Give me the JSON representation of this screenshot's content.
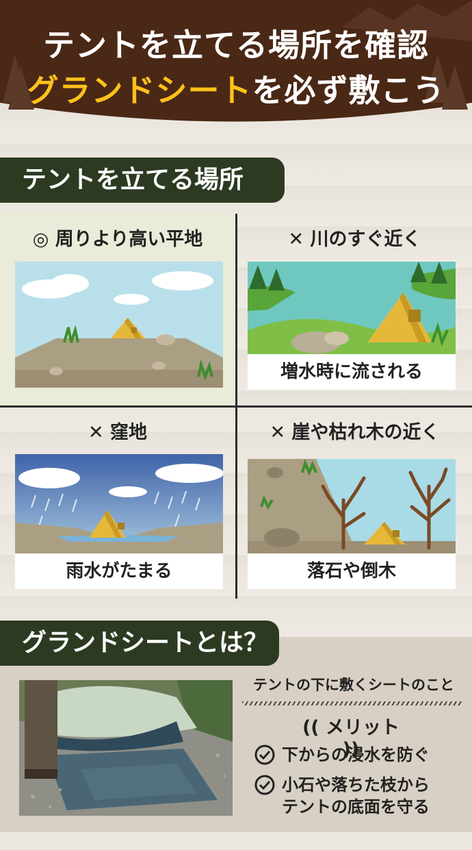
{
  "header": {
    "line1": "テントを立てる場所を確認",
    "line2_highlight": "グランドシート",
    "line2_rest": "を必ず敷こう"
  },
  "section1": {
    "title": "テントを立てる場所"
  },
  "cells": [
    {
      "symbol": "◎",
      "title": "周りより高い平地",
      "caption": ""
    },
    {
      "symbol": "✕",
      "title": "川のすぐ近く",
      "caption": "増水時に流される"
    },
    {
      "symbol": "✕",
      "title": "窪地",
      "caption": "雨水がたまる"
    },
    {
      "symbol": "✕",
      "title": "崖や枯れ木の近く",
      "caption": "落石や倒木"
    }
  ],
  "section2": {
    "title": "グランドシートとは？"
  },
  "groundsheet": {
    "description": "テントの下に敷くシートのこと",
    "merit_label": "メリット",
    "merits": [
      "下からの浸水を防ぐ",
      "小石や落ちた枝から",
      "テントの底面を守る"
    ]
  },
  "colors": {
    "dark_brown": "#4a2816",
    "dark_green": "#2d3a22",
    "yellow": "#ffc21a",
    "tent": "#e6b83a"
  }
}
